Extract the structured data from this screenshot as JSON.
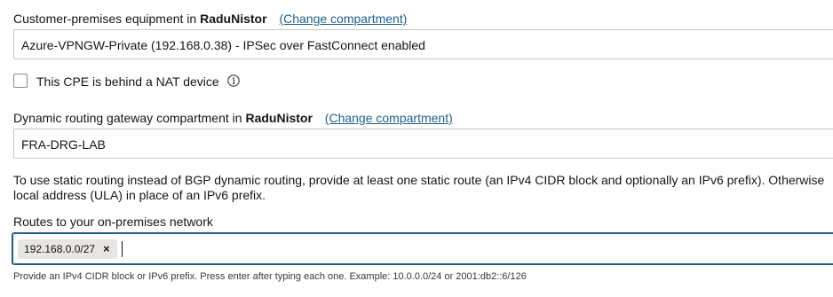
{
  "cpe": {
    "label_prefix": "Customer-premises equipment in",
    "compartment": "RaduNistor",
    "change_link": "(Change compartment)",
    "selected": "Azure-VPNGW-Private (192.168.0.38) - IPSec over FastConnect enabled"
  },
  "nat": {
    "label": "This CPE is behind a NAT device",
    "checked": false,
    "info_icon": "info-icon"
  },
  "drg": {
    "label_prefix": "Dynamic routing gateway compartment in",
    "compartment": "RaduNistor",
    "change_link": "(Change compartment)",
    "selected": "FRA-DRG-LAB"
  },
  "static_routing_help": "To use static routing instead of BGP dynamic routing, provide at least one static route (an IPv4 CIDR block and optionally an IPv6 prefix). Otherwise local address (ULA) in place of an IPv6 prefix.",
  "routes": {
    "label": "Routes to your on-premises network",
    "chips": [
      "192.168.0.0/27"
    ],
    "remove_symbol": "×",
    "hint": "Provide an IPv4 CIDR block or IPv6 prefix. Press enter after typing each one. Example: 10.0.0.0/24 or 2001:db2::6/126"
  },
  "colors": {
    "link": "#1f5f8b",
    "focus_border": "#1f5f8b",
    "chip_bg": "#e8e6e3"
  }
}
